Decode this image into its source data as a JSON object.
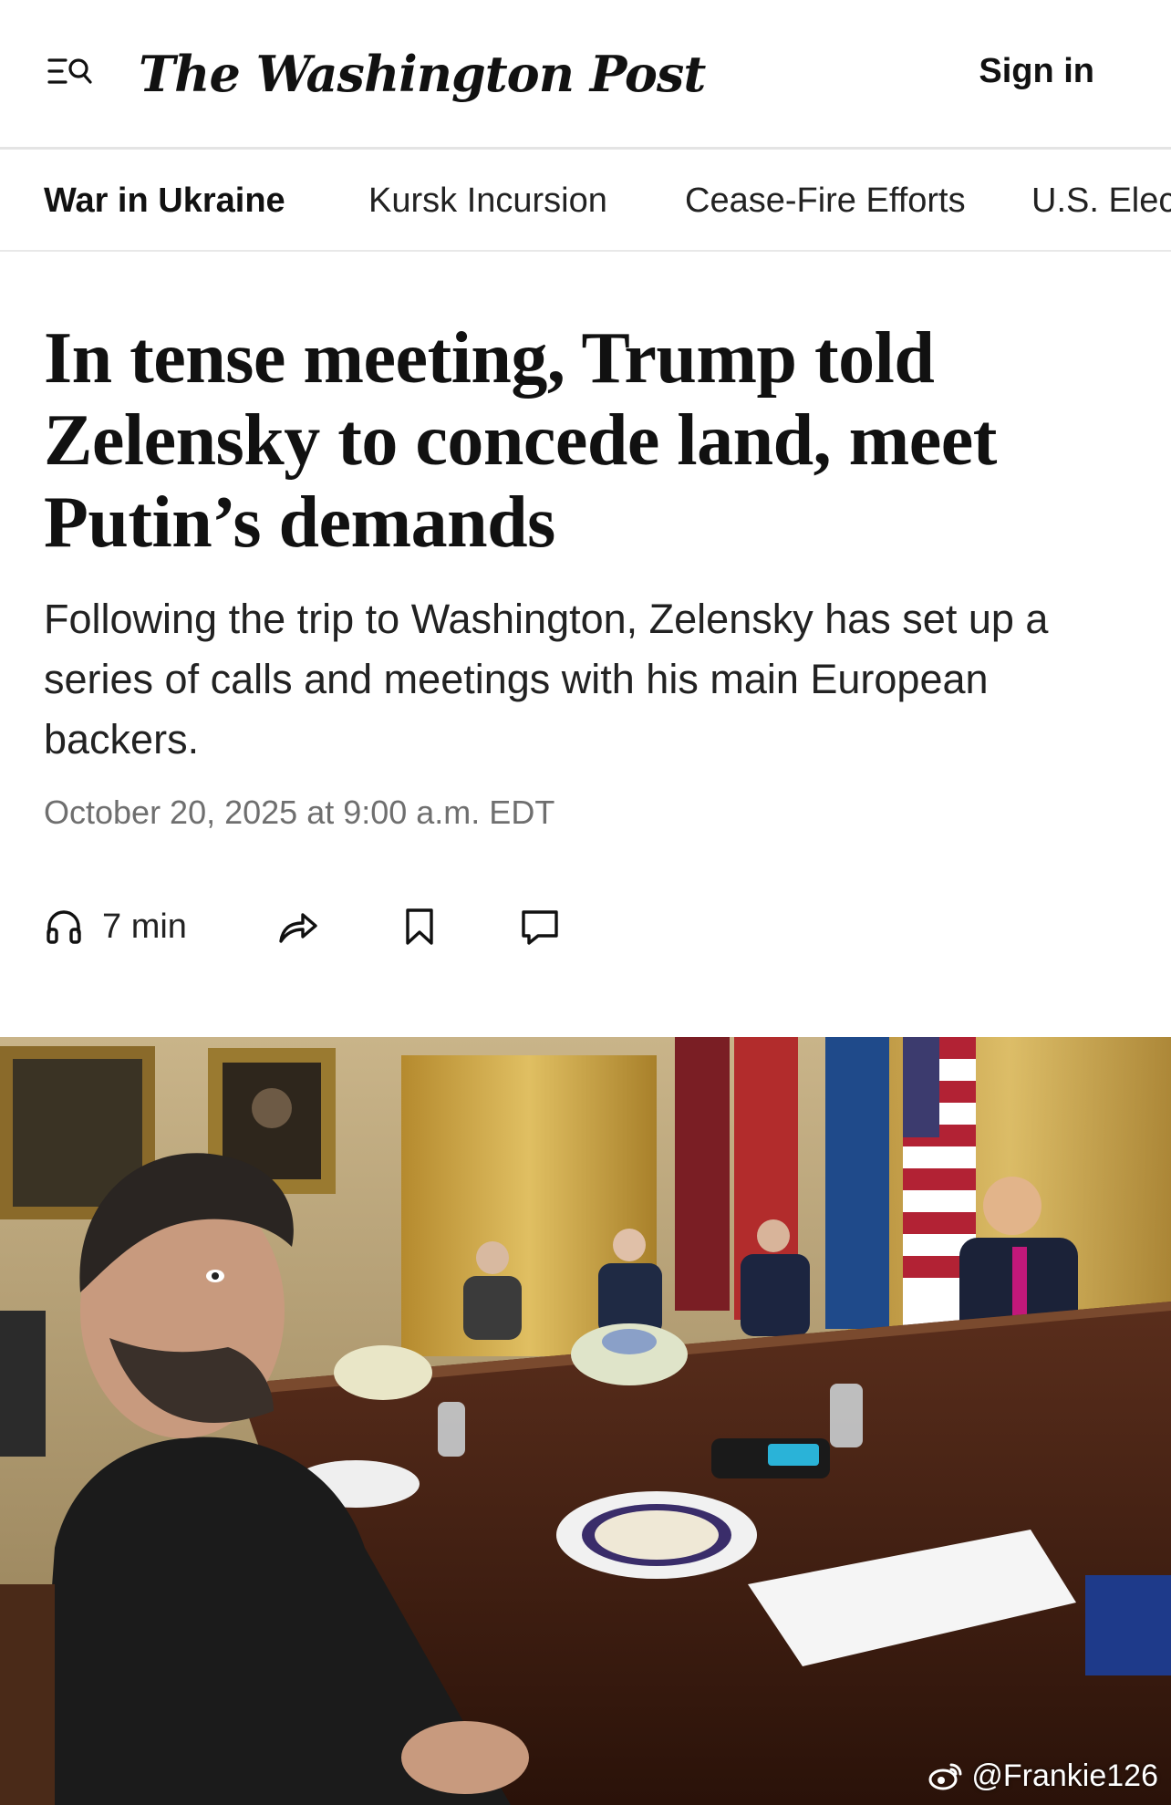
{
  "header": {
    "masthead": "The Washington Post",
    "signin_label": "Sign in",
    "menu_icon": "menu-search-icon"
  },
  "topics": [
    {
      "label": "War in Ukraine",
      "active": true
    },
    {
      "label": "Kursk Incursion",
      "active": false
    },
    {
      "label": "Cease-Fire Efforts",
      "active": false
    },
    {
      "label": "U.S. Elec",
      "active": false
    }
  ],
  "article": {
    "headline": "In tense meeting, Trump told Zelensky to concede land, meet Putin’s demands",
    "dek": "Following the trip to Washington, Zelensky has set up a series of calls and meetings with his main European backers.",
    "date": "October 20, 2025 at 9:00 a.m. EDT"
  },
  "utility": {
    "listen_time": "7 min",
    "icons": [
      "headphones-icon",
      "share-icon",
      "bookmark-icon",
      "comment-icon"
    ]
  },
  "photo": {
    "watermark": "@Frankie126"
  },
  "colors": {
    "text": "#111111",
    "muted": "#6f6f6f",
    "divider": "#e4e4e4"
  }
}
